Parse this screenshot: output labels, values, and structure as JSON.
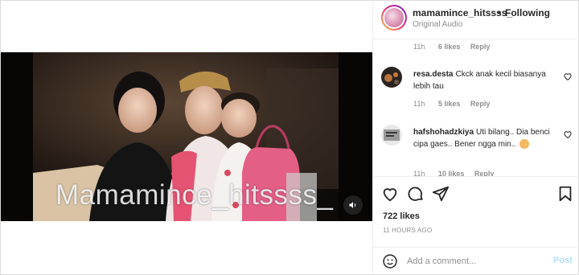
{
  "header": {
    "username": "mamamince_hitssss_",
    "separator": "•",
    "follow_status": "Following",
    "audio_label": "Original Audio"
  },
  "video": {
    "watermark": "Mamamince_hitssss_",
    "mute_icon": "speaker-muted-icon"
  },
  "comments": [
    {
      "username": "",
      "text": "",
      "time": "11h",
      "likes": "6 likes",
      "reply": "Reply"
    },
    {
      "username": "resa.desta",
      "text": "Ckck anak kecil biasanya lebih tau",
      "time": "11h",
      "likes": "5 likes",
      "reply": "Reply"
    },
    {
      "username": "hafshohadzkiya",
      "text": "Uti bilang.. Dia benci cipa gaes.. Bener ngga min..",
      "time": "11h",
      "likes": "10 likes",
      "reply": "Reply"
    }
  ],
  "actions": {
    "like_icon": "heart-icon",
    "comment_icon": "comment-icon",
    "share_icon": "send-icon",
    "save_icon": "bookmark-icon"
  },
  "likes_count": "722 likes",
  "timestamp": "11 HOURS AGO",
  "add_comment": {
    "placeholder": "Add a comment...",
    "post_label": "Post"
  },
  "colors": {
    "link_blue_disabled": "#b2dffc",
    "secondary_text": "#8e8e8e",
    "primary_text": "#262626"
  }
}
